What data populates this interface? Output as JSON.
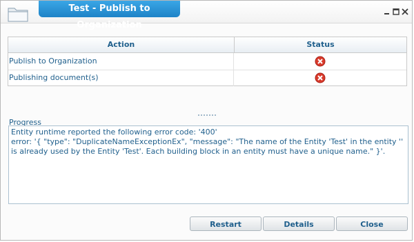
{
  "window": {
    "title": "Test - Publish to Organization",
    "icons": {
      "app": "folder-icon",
      "minimize": "minimize-icon",
      "maximize": "maximize-icon",
      "close": "close-icon"
    }
  },
  "table": {
    "headers": {
      "action": "Action",
      "status": "Status"
    },
    "rows": [
      {
        "action": "Publish to Organization",
        "status_icon": "error-icon"
      },
      {
        "action": "Publishing document(s)",
        "status_icon": "error-icon"
      }
    ]
  },
  "progress": {
    "label": "Progress",
    "lines": [
      "Entity runtime reported the following error code: '400'",
      "error: '{ \"type\": \"DuplicateNameExceptionEx\", \"message\": \"The name of the Entity 'Test' in the entity '' is already used by the Entity 'Test'. Each building block in an entity must have a unique name.\" }'."
    ]
  },
  "buttons": {
    "restart": "Restart",
    "details": "Details",
    "close": "Close"
  },
  "colors": {
    "title_tab": "#2594d8",
    "text": "#1f5f8c",
    "error": "#d93a2b"
  }
}
